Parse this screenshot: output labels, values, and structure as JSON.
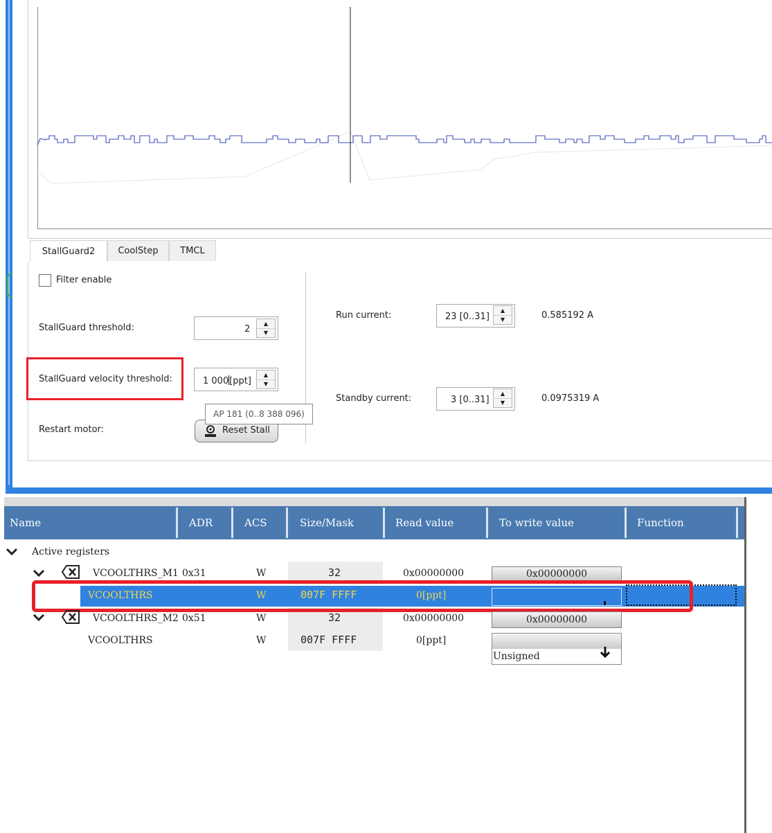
{
  "tabs": [
    {
      "label": "StallGuard2",
      "active": true
    },
    {
      "label": "CoolStep",
      "active": false
    },
    {
      "label": "TMCL",
      "active": false
    }
  ],
  "stallguard": {
    "filter_enable_label": "Filter enable",
    "filter_enable_checked": false,
    "threshold_label": "StallGuard threshold:",
    "threshold_value": "2",
    "velocity_threshold_label": "StallGuard velocity threshold:",
    "velocity_threshold_value": "1 000",
    "velocity_threshold_unit": "[ppt]",
    "velocity_tooltip": "AP 181 (0..8 388 096)",
    "restart_label": "Restart motor:",
    "reset_button_label": "Reset Stall"
  },
  "current": {
    "run_label": "Run current:",
    "run_value": "23 [0..31]",
    "run_amps": "0.585192 A",
    "standby_label": "Standby current:",
    "standby_value": "3 [0..31]",
    "standby_amps": "0.0975319 A"
  },
  "register_table": {
    "columns": [
      "Name",
      "ADR",
      "ACS",
      "Size/Mask",
      "Read value",
      "To write value",
      "Function"
    ],
    "group_label": "Active registers",
    "rows": [
      {
        "name": "VCOOLTHRS_M1",
        "adr": "0x31",
        "acs": "W",
        "size": "32",
        "read": "0x00000000",
        "write": "0x00000000"
      },
      {
        "name": "VCOOLTHRS",
        "adr": "",
        "acs": "W",
        "size": "007F FFFF",
        "read": "0[ppt]",
        "write": ""
      },
      {
        "name": "VCOOLTHRS_M2",
        "adr": "0x51",
        "acs": "W",
        "size": "32",
        "read": "0x00000000",
        "write": "0x00000000"
      },
      {
        "name": "VCOOLTHRS",
        "adr": "",
        "acs": "W",
        "size": "007F FFFF",
        "read": "0[ppt]",
        "write": "Unsigned"
      }
    ]
  },
  "colors": {
    "accent_blue": "#2f82e0",
    "header_blue": "#4a7ab0",
    "highlight_red": "#e8202a",
    "selected_text_yellow": "#f2d54a",
    "signal_line": "#3a4fb8"
  }
}
